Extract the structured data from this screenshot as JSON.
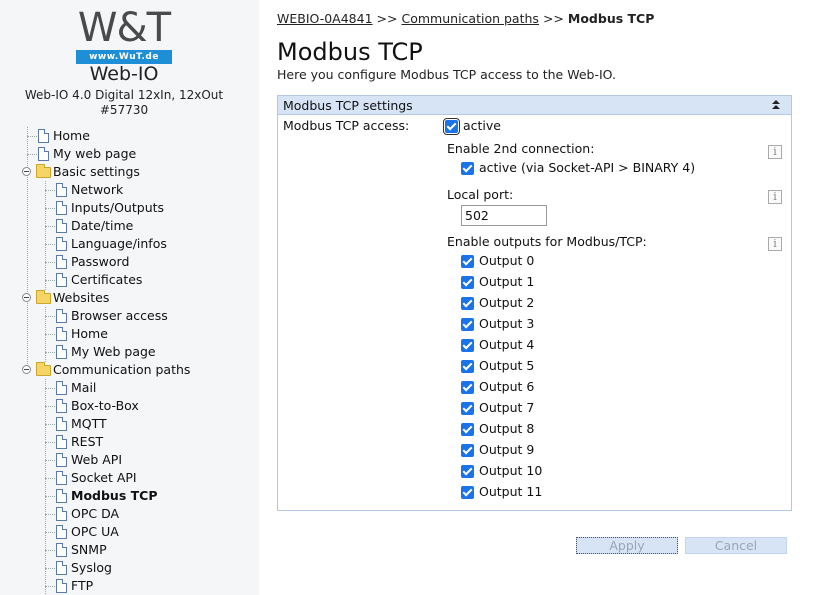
{
  "logo": {
    "brand": "W&T",
    "url": "www.WuT.de"
  },
  "device": {
    "name": "Web-IO",
    "model_line1": "Web-IO 4.0 Digital 12xIn, 12xOut",
    "model_line2": "#57730"
  },
  "nav": {
    "home": "Home",
    "my_web_page": "My web page",
    "basic_settings": "Basic settings",
    "network": "Network",
    "inputs_outputs": "Inputs/Outputs",
    "date_time": "Date/time",
    "language_infos": "Language/infos",
    "password": "Password",
    "certificates": "Certificates",
    "websites": "Websites",
    "browser_access": "Browser access",
    "websites_home": "Home",
    "my_web_page_2": "My Web page",
    "communication_paths": "Communication paths",
    "mail": "Mail",
    "box_to_box": "Box-to-Box",
    "mqtt": "MQTT",
    "rest": "REST",
    "web_api": "Web API",
    "socket_api": "Socket API",
    "modbus_tcp": "Modbus TCP",
    "opc_da": "OPC DA",
    "opc_ua": "OPC UA",
    "snmp": "SNMP",
    "syslog": "Syslog",
    "ftp": "FTP"
  },
  "breadcrumb": {
    "device": "WEBIO-0A4841",
    "sep": ">>",
    "section": "Communication paths",
    "current": "Modbus TCP"
  },
  "page": {
    "title": "Modbus TCP",
    "description": "Here you configure Modbus TCP access to the Web-IO."
  },
  "panel": {
    "title": "Modbus TCP settings",
    "access_label": "Modbus TCP access:",
    "access_value": "active",
    "second_conn_label": "Enable 2nd connection:",
    "second_conn_value": "active (via Socket-API > BINARY 4)",
    "local_port_label": "Local port:",
    "local_port_value": "502",
    "outputs_label": "Enable outputs for Modbus/TCP:",
    "info_glyph": "i",
    "outputs": [
      "Output 0",
      "Output 1",
      "Output 2",
      "Output 3",
      "Output 4",
      "Output 5",
      "Output 6",
      "Output 7",
      "Output 8",
      "Output 9",
      "Output 10",
      "Output 11"
    ]
  },
  "buttons": {
    "apply": "Apply",
    "cancel": "Cancel"
  }
}
